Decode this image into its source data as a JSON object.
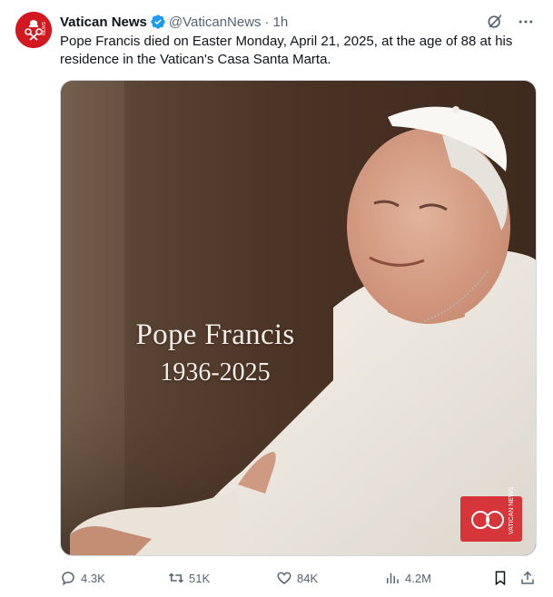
{
  "tweet": {
    "author_name": "Vatican News",
    "handle": "@VaticanNews",
    "separator": "·",
    "time": "1h",
    "text": "Pope Francis died on Easter Monday, April 21, 2025, at the age of 88 at his residence in the Vatican's Casa Santa Marta.",
    "media": {
      "overlay_title": "Pope Francis",
      "overlay_years": "1936-2025",
      "watermark": "VATICAN NEWS"
    },
    "avatar_text": "NEWS"
  },
  "actions": {
    "replies": "4.3K",
    "reposts": "51K",
    "likes": "84K",
    "views": "4.2M"
  },
  "icons": [
    "verified-badge-icon",
    "grok-icon",
    "more-icon",
    "reply-icon",
    "repost-icon",
    "like-icon",
    "views-icon",
    "bookmark-icon",
    "share-icon"
  ],
  "colors": {
    "brand": "#d3191f",
    "verified": "#1d9bf0",
    "muted": "#536471"
  }
}
